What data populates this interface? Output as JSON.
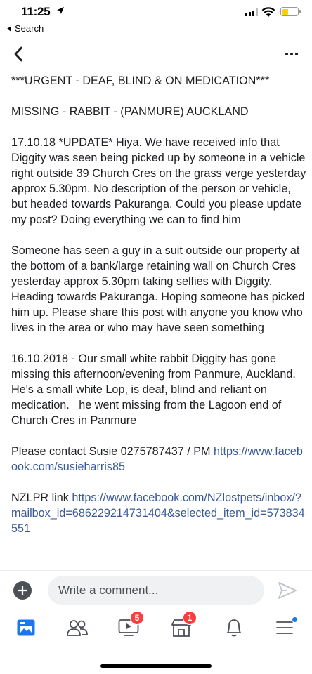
{
  "status_bar": {
    "time": "11:25",
    "back_label": "Search",
    "battery_color": "#f5d20a"
  },
  "nav": {
    "back_icon": "chevron-left-icon",
    "more_icon": "more-horizontal-icon"
  },
  "post": {
    "heading": "***URGENT - DEAF, BLIND & ON MEDICATION***",
    "subheading": "MISSING - RABBIT - (PANMURE) AUCKLAND",
    "update_text": "17.10.18 *UPDATE* Hiya. We have received info that Diggity was seen being picked up by someone in a vehicle right outside 39 Church Cres on the grass verge yesterday approx 5.30pm. No description of the person or vehicle, but headed towards Pakuranga. Could you please update my post? Doing everything we can to find him",
    "sighting_text": "Someone has seen a guy in a suit outside our property at the bottom of a bank/large retaining wall on Church Cres yesterday approx 5.30pm taking selfies with Diggity. Heading towards Pakuranga. Hoping someone has picked him up. Please share this post with anyone you know who lives in the area or who may have seen something",
    "original_text": "16.10.2018 - Our small white rabbit Diggity has gone missing this afternoon/evening from Panmure, Auckland. He's a small white Lop, is deaf, blind and reliant on medication.   he went missing from the Lagoon end of Church Cres in Panmure",
    "contact_text": "Please contact Susie 0275787437 / PM ",
    "contact_link": "https://www.facebook.com/susieharris85",
    "nzlpr_text": "NZLPR link ",
    "nzlpr_link": "https://www.facebook.com/NZlostpets/inbox/?mailbox_id=686229214731404&selected_item_id=573834551",
    "link_color": "#385898"
  },
  "comment": {
    "placeholder": "Write a comment...",
    "send_icon": "send-icon",
    "add_icon": "plus-circle-icon"
  },
  "tab_bar": {
    "tabs": [
      {
        "icon": "news-feed-icon",
        "active": true
      },
      {
        "icon": "friends-icon"
      },
      {
        "icon": "watch-icon",
        "badge": "5"
      },
      {
        "icon": "marketplace-icon",
        "badge": "1"
      },
      {
        "icon": "notifications-bell-icon"
      },
      {
        "icon": "menu-icon",
        "dot": true
      }
    ],
    "active_color": "#1877f2",
    "badge_color": "#fa3e3e"
  }
}
